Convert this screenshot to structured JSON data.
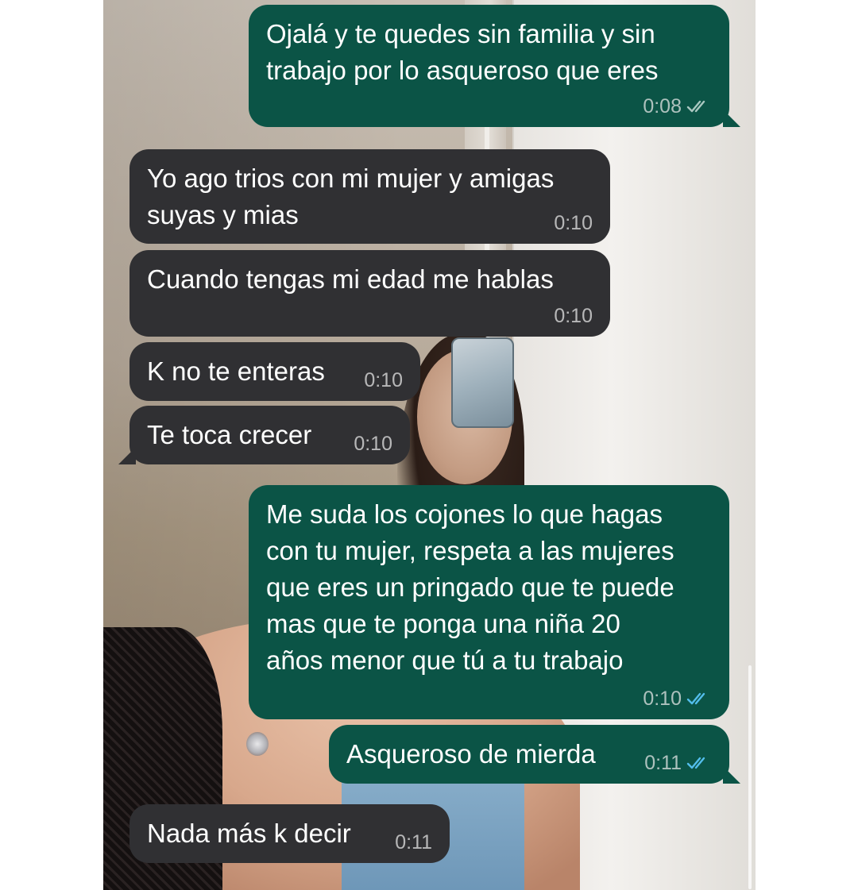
{
  "colors": {
    "incoming_bubble": "#303033",
    "outgoing_bubble": "#0b5446",
    "read_tick": "#53bdeb",
    "sent_tick": "#a9c7c0"
  },
  "messages": [
    {
      "direction": "outgoing",
      "text": "Ojalá y te quedes sin familia y sin\ntrabajo por lo asqueroso que eres",
      "time": "0:08",
      "status": "delivered",
      "status_icon": "double-check-icon"
    },
    {
      "direction": "incoming",
      "text": "Yo ago trios con mi mujer y amigas\nsuyas y mias",
      "time": "0:10"
    },
    {
      "direction": "incoming",
      "text": "Cuando tengas mi edad me hablas",
      "time": "0:10"
    },
    {
      "direction": "incoming",
      "text": "K no te enteras",
      "time": "0:10"
    },
    {
      "direction": "incoming",
      "text": "Te toca crecer",
      "time": "0:10"
    },
    {
      "direction": "outgoing",
      "text": "Me suda los cojones lo que hagas\ncon tu mujer, respeta a las mujeres\nque eres un pringado que te puede\nmas que te ponga una niña 20\naños menor que tú a tu trabajo",
      "time": "0:10",
      "status": "read",
      "status_icon": "double-check-blue-icon"
    },
    {
      "direction": "outgoing",
      "text": "Asqueroso de mierda",
      "time": "0:11",
      "status": "read",
      "status_icon": "double-check-blue-icon"
    },
    {
      "direction": "incoming",
      "text": "Nada más k decir",
      "time": "0:11"
    }
  ]
}
